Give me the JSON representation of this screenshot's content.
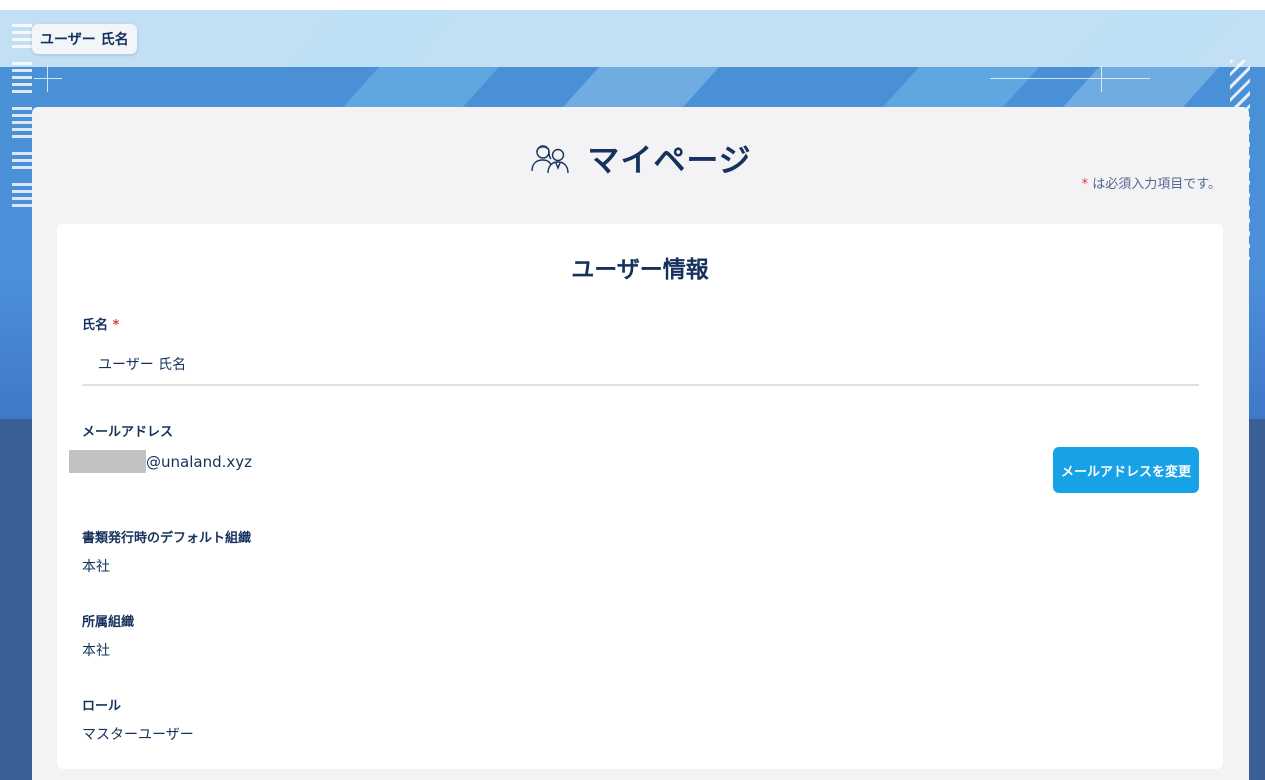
{
  "header": {
    "user_chip": "ユーザー 氏名"
  },
  "page": {
    "title": "マイページ",
    "title_icon": "users-icon",
    "required_note_star": "*",
    "required_note": "は必須入力項目です。"
  },
  "card": {
    "title": "ユーザー情報",
    "fields": {
      "name": {
        "label": "氏名",
        "required_star": "*",
        "value": "ユーザー 氏名"
      },
      "email": {
        "label": "メールアドレス",
        "domain": "@unaland.xyz",
        "change_button": "メールアドレスを変更"
      },
      "default_org": {
        "label": "書類発行時のデフォルト組織",
        "value": "本社"
      },
      "affiliation": {
        "label": "所属組織",
        "value": "本社"
      },
      "role": {
        "label": "ロール",
        "value": "マスターユーザー"
      }
    }
  },
  "colors": {
    "primary_button": "#17a1e6",
    "text": "#16325c",
    "required": "#e2383b",
    "background": "#3d5f96"
  }
}
